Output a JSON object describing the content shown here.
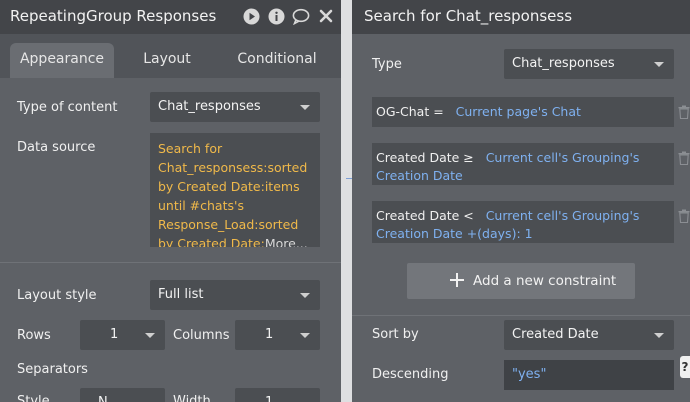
{
  "left_panel": {
    "title": "RepeatingGroup Responses",
    "tabs": [
      {
        "label": "Appearance",
        "active": true
      },
      {
        "label": "Layout",
        "active": false
      },
      {
        "label": "Conditional",
        "active": false
      }
    ],
    "type_of_content_label": "Type of content",
    "type_of_content_value": "Chat_responses",
    "data_source_label": "Data source",
    "data_source_text": "Search for Chat_responsess:sorted by Created Date:items until #chats's Response_Load:sorted by Created Date:",
    "data_source_more": "More...",
    "layout_style_label": "Layout style",
    "layout_style_value": "Full list",
    "rows_label": "Rows",
    "rows_value": "1",
    "columns_label": "Columns",
    "columns_value": "1",
    "separators_label": "Separators",
    "style_label": "Style",
    "style_value": "N",
    "width_label": "Width",
    "width_value": "1"
  },
  "right_panel": {
    "title": "Search for Chat_responsess",
    "type_label": "Type",
    "type_value": "Chat_responses",
    "constraints": [
      {
        "field": "OG-Chat =",
        "value": "Current page's Chat"
      },
      {
        "field": "Created Date ≥",
        "value": "Current cell's Grouping's Creation Date"
      },
      {
        "field": "Created Date <",
        "value": "Current cell's Grouping's Creation Date +(days): 1"
      }
    ],
    "add_constraint_label": "Add a new constraint",
    "sort_by_label": "Sort by",
    "sort_by_value": "Created Date",
    "descending_label": "Descending",
    "descending_value": "\"yes\"",
    "help_label": "?"
  },
  "colors": {
    "dynamic_expression": "#f0b94a",
    "constraint_value": "#7fb1f0",
    "panel_bg": "#5e6166",
    "header_bg": "#434549"
  },
  "icons": [
    "play-icon",
    "info-icon",
    "comment-icon",
    "close-icon",
    "trash-icon",
    "plus-icon",
    "caret-down-icon"
  ]
}
